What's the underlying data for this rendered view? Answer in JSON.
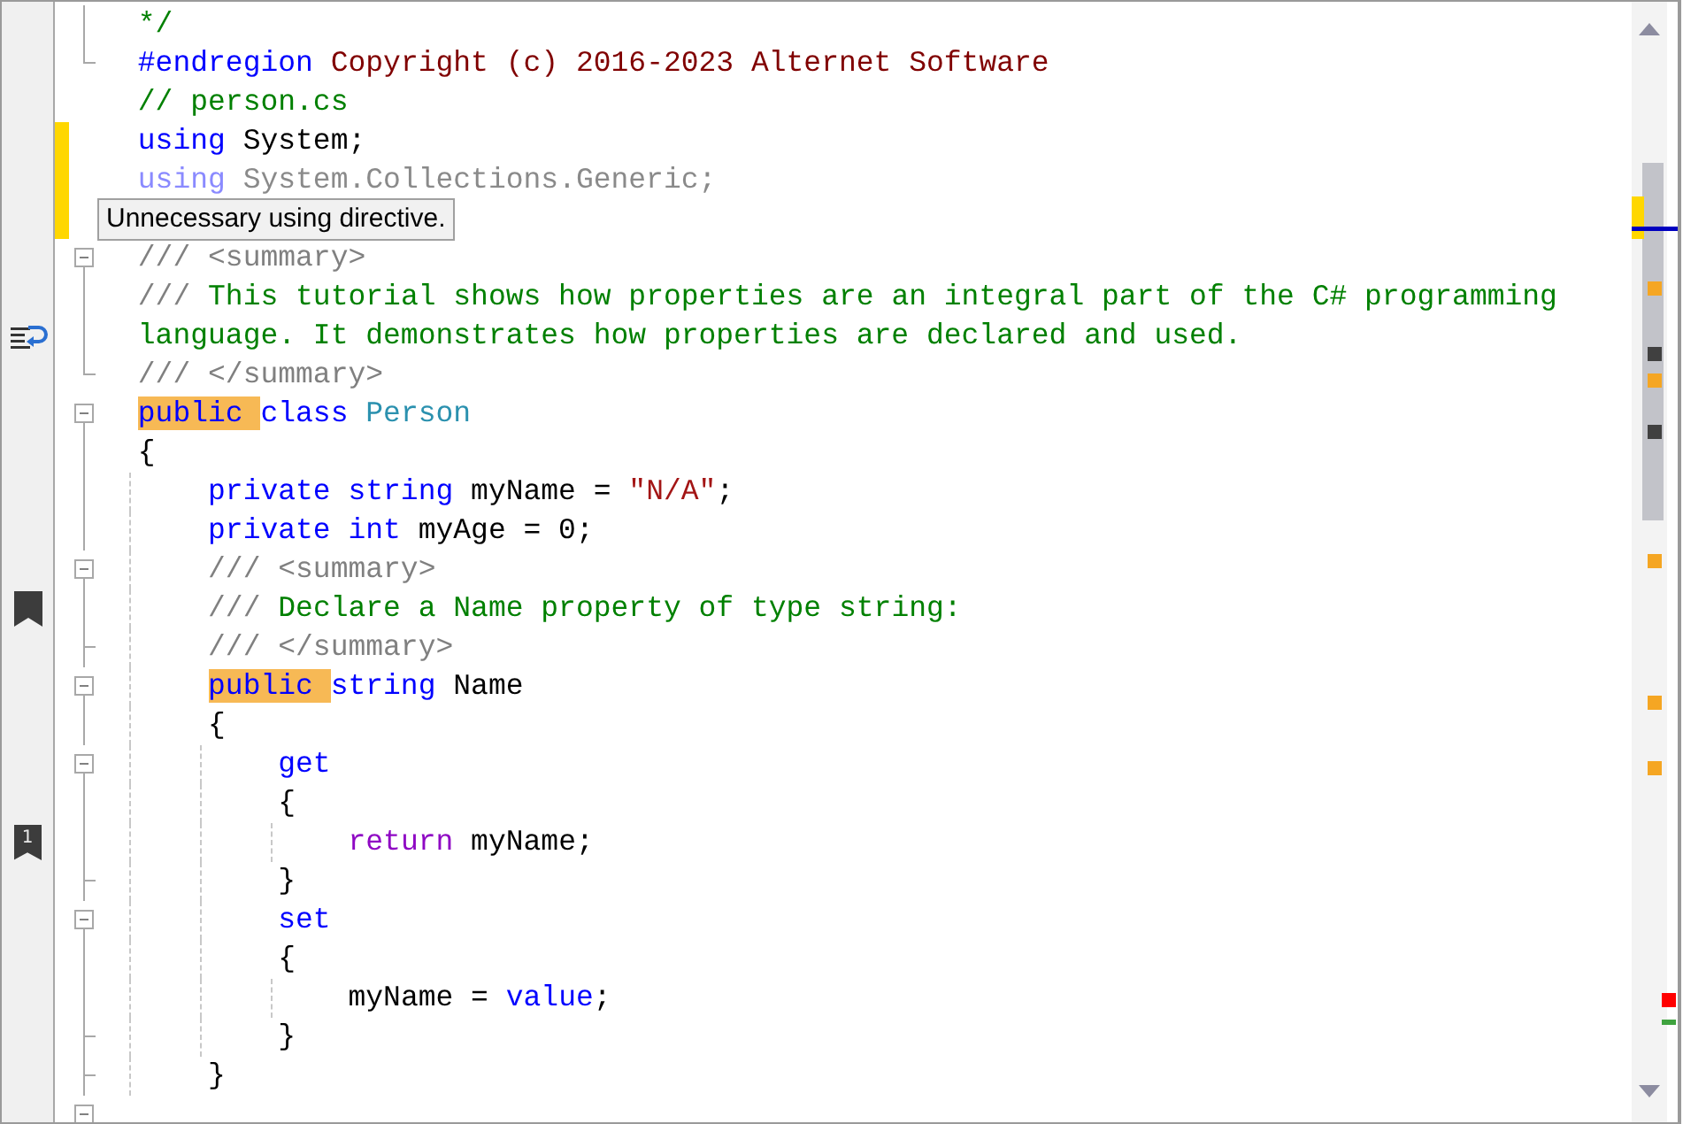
{
  "tooltip": {
    "text": "Unnecessary using directive."
  },
  "lines": [
    {
      "fold": {
        "kind": "line"
      },
      "tokens": [
        {
          "kind": "comment",
          "text": "*/"
        }
      ]
    },
    {
      "fold": {
        "kind": "end"
      },
      "tokens": [
        {
          "kind": "preproc",
          "text": "#endregion"
        },
        {
          "kind": "region",
          "text": " Copyright (c) 2016-2023 Alternet Software"
        }
      ]
    },
    {
      "tokens": [
        {
          "kind": "comment",
          "text": "// person.cs"
        }
      ]
    },
    {
      "changed": true,
      "tokens": [
        {
          "kind": "keyword",
          "text": "using"
        },
        {
          "kind": "plain",
          "text": " System;"
        }
      ]
    },
    {
      "changed": true,
      "tokens": [
        {
          "kind": "faded-keyword",
          "text": "using"
        },
        {
          "kind": "faded",
          "text": " System.Collections.Generic;"
        }
      ]
    },
    {
      "changed": true
    },
    {
      "fold": {
        "kind": "start"
      },
      "tokens": [
        {
          "kind": "doc",
          "text": "/// <summary>"
        }
      ]
    },
    {
      "fold": {
        "kind": "line"
      },
      "tokens": [
        {
          "kind": "doc",
          "text": "///"
        },
        {
          "kind": "comment",
          "text": " This tutorial shows how properties are an integral part of the C# programming"
        }
      ]
    },
    {
      "fold": {
        "kind": "line"
      },
      "marker": {
        "kind": "wrap"
      },
      "tokens": [
        {
          "kind": "comment",
          "text": "language. It demonstrates how properties are declared and used."
        }
      ]
    },
    {
      "fold": {
        "kind": "end"
      },
      "tokens": [
        {
          "kind": "doc",
          "text": "/// </summary>"
        }
      ]
    },
    {
      "fold": {
        "kind": "start"
      },
      "tokens": [
        {
          "kind": "keyword",
          "text": "public ",
          "highlighted": true
        },
        {
          "kind": "keyword",
          "text": "class"
        },
        {
          "kind": "type",
          "text": " Person"
        }
      ]
    },
    {
      "fold": {
        "kind": "line"
      },
      "tokens": [
        {
          "kind": "plain",
          "text": "{"
        }
      ]
    },
    {
      "fold": {
        "kind": "line"
      },
      "tokens": [
        {
          "kind": "keyword",
          "text": "    private"
        },
        {
          "kind": "keyword",
          "text": " string"
        },
        {
          "kind": "plain",
          "text": " myName = "
        },
        {
          "kind": "string",
          "text": "\"N/A\""
        },
        {
          "kind": "plain",
          "text": ";"
        }
      ]
    },
    {
      "fold": {
        "kind": "line"
      },
      "tokens": [
        {
          "kind": "keyword",
          "text": "    private"
        },
        {
          "kind": "keyword",
          "text": " int"
        },
        {
          "kind": "plain",
          "text": " myAge = 0;"
        }
      ]
    },
    {
      "fold": {
        "kind": "start"
      },
      "tokens": [
        {
          "kind": "doc",
          "text": "    /// <summary>"
        }
      ]
    },
    {
      "fold": {
        "kind": "line"
      },
      "marker": {
        "kind": "bookmark"
      },
      "tokens": [
        {
          "kind": "doc",
          "text": "    ///"
        },
        {
          "kind": "comment",
          "text": " Declare a Name property of type string:"
        }
      ]
    },
    {
      "fold": {
        "kind": "inner-end"
      },
      "tokens": [
        {
          "kind": "doc",
          "text": "    /// </summary>"
        }
      ]
    },
    {
      "fold": {
        "kind": "start"
      },
      "tokens": [
        {
          "kind": "keyword",
          "text": "    public ",
          "highlighted": true
        },
        {
          "kind": "keyword",
          "text": "string"
        },
        {
          "kind": "plain",
          "text": " Name"
        }
      ]
    },
    {
      "fold": {
        "kind": "line"
      },
      "tokens": [
        {
          "kind": "plain",
          "text": "    {"
        }
      ]
    },
    {
      "fold": {
        "kind": "start"
      },
      "tokens": [
        {
          "kind": "keyword",
          "text": "        get"
        }
      ]
    },
    {
      "fold": {
        "kind": "line"
      },
      "tokens": [
        {
          "kind": "plain",
          "text": "        {"
        }
      ]
    },
    {
      "fold": {
        "kind": "line"
      },
      "marker": {
        "kind": "numbered-bookmark",
        "label": "1"
      },
      "tokens": [
        {
          "kind": "control",
          "text": "            return"
        },
        {
          "kind": "plain",
          "text": " myName;"
        }
      ]
    },
    {
      "fold": {
        "kind": "inner-end"
      },
      "tokens": [
        {
          "kind": "plain",
          "text": "        }"
        }
      ]
    },
    {
      "fold": {
        "kind": "start"
      },
      "tokens": [
        {
          "kind": "keyword",
          "text": "        set"
        }
      ]
    },
    {
      "fold": {
        "kind": "line"
      },
      "tokens": [
        {
          "kind": "plain",
          "text": "        {"
        }
      ]
    },
    {
      "fold": {
        "kind": "line"
      },
      "tokens": [
        {
          "kind": "plain",
          "text": "            myName = "
        },
        {
          "kind": "keyword",
          "text": "value"
        },
        {
          "kind": "plain",
          "text": ";"
        }
      ]
    },
    {
      "fold": {
        "kind": "inner-end"
      },
      "tokens": [
        {
          "kind": "plain",
          "text": "        }"
        }
      ]
    },
    {
      "fold": {
        "kind": "inner-end"
      },
      "tokens": [
        {
          "kind": "plain",
          "text": "    }"
        }
      ]
    },
    {
      "fold": {
        "kind": "start"
      }
    }
  ]
}
